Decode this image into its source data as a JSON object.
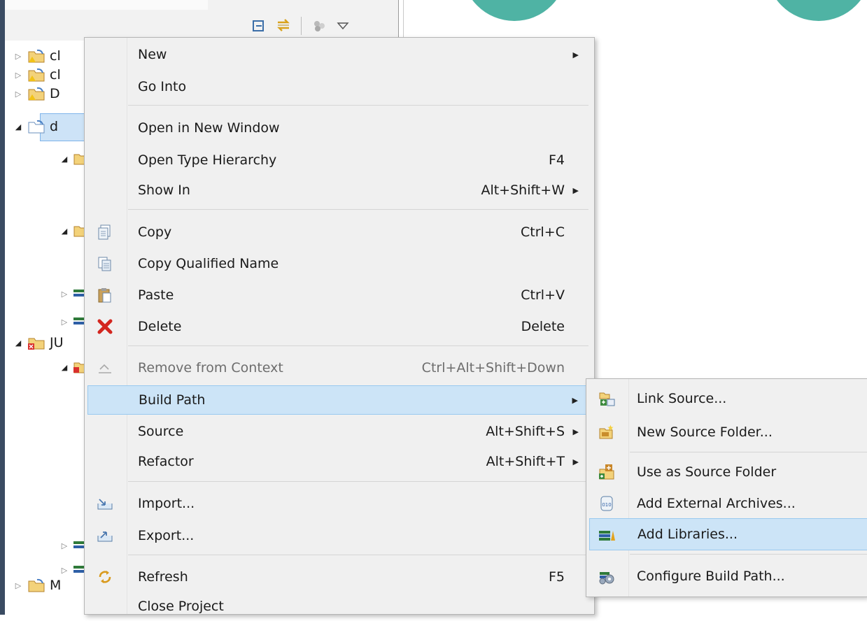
{
  "toolbar": {
    "icons": [
      "collapse-all-icon",
      "link-with-editor-icon",
      "filters-icon",
      "view-menu-icon"
    ]
  },
  "explorer": {
    "rows": [
      {
        "label": "cl",
        "icon": "project-warning-icon",
        "expanded": false
      },
      {
        "label": "cl",
        "icon": "project-warning-icon",
        "expanded": false
      },
      {
        "label": "D",
        "icon": "project-warning-icon",
        "expanded": false
      },
      {
        "label": "d",
        "icon": "project-icon",
        "expanded": true,
        "selected": true
      },
      {
        "label": "JU",
        "icon": "project-error-icon",
        "expanded": true
      },
      {
        "label": "M",
        "icon": "project-warning-icon",
        "expanded": false
      }
    ]
  },
  "context_menu": {
    "items": [
      {
        "label": "New",
        "shortcut": "",
        "submenu": true,
        "icon": ""
      },
      {
        "label": "Go Into",
        "shortcut": "",
        "submenu": false,
        "icon": ""
      },
      {
        "label": "Open in New Window",
        "shortcut": "",
        "submenu": false,
        "icon": ""
      },
      {
        "label": "Open Type Hierarchy",
        "shortcut": "F4",
        "submenu": false,
        "icon": ""
      },
      {
        "label": "Show In",
        "shortcut": "Alt+Shift+W",
        "submenu": true,
        "icon": ""
      },
      {
        "label": "Copy",
        "shortcut": "Ctrl+C",
        "submenu": false,
        "icon": "copy-icon"
      },
      {
        "label": "Copy Qualified Name",
        "shortcut": "",
        "submenu": false,
        "icon": "copy-qualified-name-icon"
      },
      {
        "label": "Paste",
        "shortcut": "Ctrl+V",
        "submenu": false,
        "icon": "paste-icon"
      },
      {
        "label": "Delete",
        "shortcut": "Delete",
        "submenu": false,
        "icon": "delete-icon"
      },
      {
        "label": "Remove from Context",
        "shortcut": "Ctrl+Alt+Shift+Down",
        "submenu": false,
        "icon": "remove-from-context-icon",
        "disabled": true
      },
      {
        "label": "Build Path",
        "shortcut": "",
        "submenu": true,
        "icon": "",
        "highlighted": true
      },
      {
        "label": "Source",
        "shortcut": "Alt+Shift+S",
        "submenu": true,
        "icon": ""
      },
      {
        "label": "Refactor",
        "shortcut": "Alt+Shift+T",
        "submenu": true,
        "icon": ""
      },
      {
        "label": "Import...",
        "shortcut": "",
        "submenu": false,
        "icon": "import-icon"
      },
      {
        "label": "Export...",
        "shortcut": "",
        "submenu": false,
        "icon": "export-icon"
      },
      {
        "label": "Refresh",
        "shortcut": "F5",
        "submenu": false,
        "icon": "refresh-icon"
      },
      {
        "label": "Close Project",
        "shortcut": "",
        "submenu": false,
        "icon": ""
      }
    ]
  },
  "build_path_submenu": {
    "items": [
      {
        "label": "Link Source...",
        "icon": "link-source-icon"
      },
      {
        "label": "New Source Folder...",
        "icon": "new-source-folder-icon"
      },
      {
        "label": "Use as Source Folder",
        "icon": "use-as-source-folder-icon"
      },
      {
        "label": "Add External Archives...",
        "icon": "jar-archive-icon"
      },
      {
        "label": "Add Libraries...",
        "icon": "library-icon",
        "highlighted": true
      },
      {
        "label": "Configure Build Path...",
        "icon": "configure-build-path-icon"
      }
    ]
  },
  "colors": {
    "highlight": "#cce4f7",
    "menu_bg": "#f0f0f0",
    "accent_teal": "#4fb3a4"
  }
}
